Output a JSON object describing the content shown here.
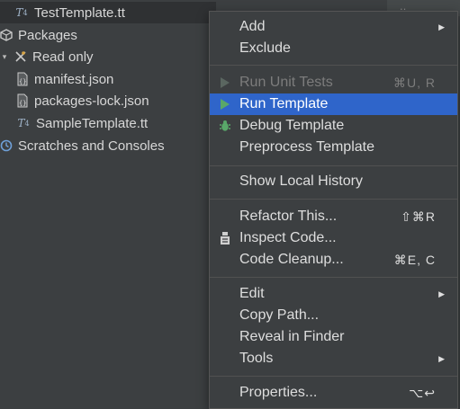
{
  "tree": {
    "items": [
      {
        "label": "TestTemplate.tt",
        "icon": "t4-file-icon"
      },
      {
        "label": "Packages",
        "icon": "package-icon"
      },
      {
        "label": "Read only",
        "icon": "readonly-icon"
      },
      {
        "label": "manifest.json",
        "icon": "json-file-icon"
      },
      {
        "label": "packages-lock.json",
        "icon": "json-file-icon"
      },
      {
        "label": "SampleTemplate.tt",
        "icon": "t4-file-icon"
      },
      {
        "label": "Scratches and Consoles",
        "icon": "scratches-icon"
      }
    ],
    "corner_text": "‥"
  },
  "context_menu": {
    "items": [
      {
        "label": "Add",
        "shortcut": "",
        "submenu": true,
        "state": "normal"
      },
      {
        "label": "Exclude",
        "shortcut": "",
        "submenu": false,
        "state": "normal"
      },
      {
        "label": "Run Unit Tests",
        "shortcut": "⌘U, R",
        "submenu": false,
        "state": "disabled"
      },
      {
        "label": "Run Template",
        "shortcut": "",
        "submenu": false,
        "state": "highlighted"
      },
      {
        "label": "Debug Template",
        "shortcut": "",
        "submenu": false,
        "state": "normal"
      },
      {
        "label": "Preprocess Template",
        "shortcut": "",
        "submenu": false,
        "state": "normal"
      },
      {
        "label": "Show Local History",
        "shortcut": "",
        "submenu": false,
        "state": "normal"
      },
      {
        "label": "Refactor This...",
        "shortcut": "⇧⌘R",
        "submenu": false,
        "state": "normal"
      },
      {
        "label": "Inspect Code...",
        "shortcut": "",
        "submenu": false,
        "state": "normal"
      },
      {
        "label": "Code Cleanup...",
        "shortcut": "⌘E, C",
        "submenu": false,
        "state": "normal"
      },
      {
        "label": "Edit",
        "shortcut": "",
        "submenu": true,
        "state": "normal"
      },
      {
        "label": "Copy Path...",
        "shortcut": "",
        "submenu": false,
        "state": "normal"
      },
      {
        "label": "Reveal in Finder",
        "shortcut": "",
        "submenu": false,
        "state": "normal"
      },
      {
        "label": "Tools",
        "shortcut": "",
        "submenu": true,
        "state": "normal"
      },
      {
        "label": "Properties...",
        "shortcut": "⌥↩",
        "submenu": false,
        "state": "normal"
      }
    ],
    "submenu_arrow": "▶"
  },
  "colors": {
    "menu_highlight": "#2f65ca",
    "run_icon": "#59a869",
    "debug_icon": "#59a869"
  }
}
